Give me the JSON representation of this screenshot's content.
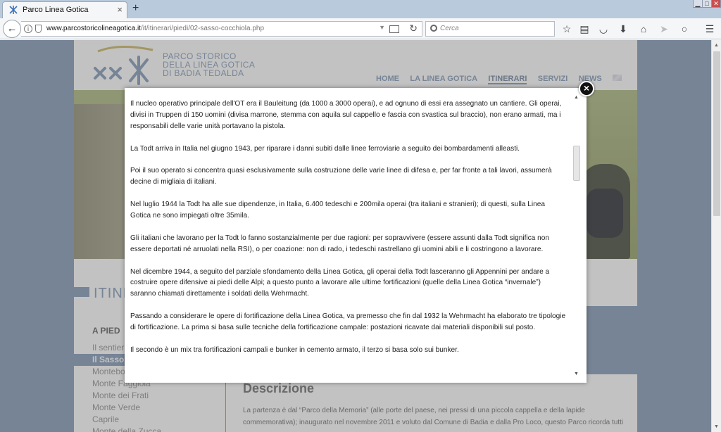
{
  "browser": {
    "tab": {
      "title": "Parco Linea Gotica",
      "close": "×"
    },
    "new_tab": "+",
    "window_buttons": {
      "minimize": "▁",
      "maximize": "□",
      "close": "✕"
    },
    "url": {
      "host": "www.parcostoricolineagotica.it",
      "path": "/it/itinerari/piedi/02-sasso-cocchiola.php"
    },
    "search_placeholder": "Cerca",
    "icons": [
      "back-arrow-icon",
      "info-icon",
      "shield-icon",
      "reader-view-icon",
      "reload-icon",
      "search-icon",
      "bookmark-star-icon",
      "reading-list-icon",
      "pocket-icon",
      "download-icon",
      "home-icon",
      "send-icon",
      "chat-icon",
      "menu-icon"
    ]
  },
  "site": {
    "logo_lines": [
      "PARCO STORICO",
      "DELLA LINEA GOTICA",
      "DI BADIA TEDALDA"
    ],
    "nav": [
      "HOME",
      "LA LINEA GOTICA",
      "ITINERARI",
      "SERVIZI",
      "NEWS"
    ],
    "section_heading": "ITINE",
    "sub_heading": "A PIED",
    "side_items": [
      "Il sentier",
      "Il Sasso",
      "Montebo",
      "Monte Faggiola",
      "Monte dei Frati",
      "Monte Verde",
      "Caprile",
      "Monte della Zucca"
    ],
    "descrizione_title": "Descrizione",
    "descrizione_text": "La partenza è dal “Parco della Memoria” (alle porte del paese, nei pressi di una piccola cappella e della lapide commemorativa); inaugurato nel novembre 2011 e voluto dal Comune di Badia e dalla Pro Loco, questo Parco ricorda tutti"
  },
  "modal": {
    "paragraphs": [
      "Il nucleo operativo principale dell'OT era il Bauleitung (da 1000 a 3000 operai), e ad ognuno di essi era assegnato un cantiere. Gli operai, divisi in Truppen di 150 uomini (divisa marrone, stemma con aquila sul cappello e fascia con svastica sul braccio), non erano armati, ma i responsabili delle varie unità portavano la pistola.",
      "La Todt arriva in Italia nel giugno 1943, per riparare i danni subiti dalle linee ferroviarie a seguito dei bombardamenti alleasti.",
      "Poi il suo operato si concentra quasi esclusivamente sulla costruzione delle varie linee di difesa e, per far fronte a tali lavori, assumerà decine di migliaia di italiani.",
      "Nel luglio 1944 la Todt ha alle sue dipendenze, in Italia, 6.400 tedeschi e 200mila operai (tra italiani e stranieri); di questi, sulla Linea Gotica ne sono impiegati oltre 35mila.",
      "Gli italiani che lavorano per la Todt lo fanno sostanzialmente per due ragioni: per sopravvivere (essere assunti dalla Todt significa non essere deportati né arruolati nella RSI), o per coazione: non di rado, i tedeschi rastrellano gli uomini abili e li costringono a lavorare.",
      "Nel dicembre 1944, a seguito del parziale sfondamento della Linea Gotica, gli operai della Todt lasceranno gli Appennini per andare a costruire opere difensive ai piedi delle Alpi; a questo punto a lavorare alle ultime fortificazioni (quelle della Linea Gotica “invernale”) saranno chiamati direttamente i soldati della Wehrmacht.",
      "Passando a considerare le opere di fortificazione della Linea Gotica, va premesso che fin dal 1932 la Wehrmacht ha elaborato tre tipologie di fortificazione. La prima si basa sulle tecniche della fortificazione campale: postazioni ricavate dai materiali disponibili sul posto.",
      "Il secondo è un mix tra fortificazioni campali e bunker in cemento armato, il terzo si basa solo sui bunker."
    ],
    "close": "×"
  },
  "colors": {
    "accent": "#7c95b4",
    "overlay": "rgba(110,110,110,0.42)"
  }
}
